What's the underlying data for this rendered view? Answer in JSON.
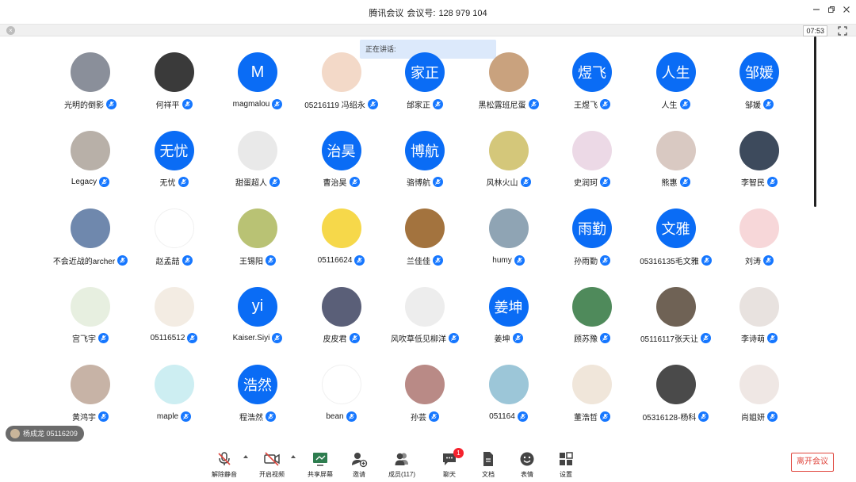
{
  "window": {
    "app_name": "腾讯会议",
    "meeting_label": "会议号:",
    "meeting_id": "128 979 104"
  },
  "infobar": {
    "timer": "07:53"
  },
  "speaking": {
    "label": "正在讲话:"
  },
  "participants": [
    {
      "name": "光明的倒影",
      "avatar_text": "",
      "kind": "pic",
      "color": "#8a8f9a"
    },
    {
      "name": "何祥平",
      "avatar_text": "",
      "kind": "pic",
      "color": "#3a3a3a"
    },
    {
      "name": "magmalou",
      "avatar_text": "M",
      "kind": "blue"
    },
    {
      "name": "05216119 冯绍永",
      "avatar_text": "",
      "kind": "pic",
      "color": "#f3d9c8"
    },
    {
      "name": "邰家正",
      "avatar_text": "家正",
      "kind": "blue"
    },
    {
      "name": "黑松露班尼蛋",
      "avatar_text": "",
      "kind": "pic",
      "color": "#c9a27e"
    },
    {
      "name": "王煜飞",
      "avatar_text": "煜飞",
      "kind": "blue"
    },
    {
      "name": "人生",
      "avatar_text": "人生",
      "kind": "blue"
    },
    {
      "name": "邹媛",
      "avatar_text": "邹媛",
      "kind": "blue"
    },
    {
      "name": "Legacy",
      "avatar_text": "",
      "kind": "pic",
      "color": "#b8b0a8"
    },
    {
      "name": "无忧",
      "avatar_text": "无忧",
      "kind": "blue"
    },
    {
      "name": "甜蛋超人",
      "avatar_text": "",
      "kind": "pic",
      "color": "#e9e9e9"
    },
    {
      "name": "曹治昊",
      "avatar_text": "治昊",
      "kind": "blue"
    },
    {
      "name": "骆博航",
      "avatar_text": "博航",
      "kind": "blue"
    },
    {
      "name": "风林火山",
      "avatar_text": "",
      "kind": "pic",
      "color": "#d4c77a"
    },
    {
      "name": "史润珂",
      "avatar_text": "",
      "kind": "pic",
      "color": "#ecd9e6"
    },
    {
      "name": "熊惠",
      "avatar_text": "",
      "kind": "pic",
      "color": "#d9c9c2"
    },
    {
      "name": "李智民",
      "avatar_text": "",
      "kind": "pic",
      "color": "#3d4a5c"
    },
    {
      "name": "不会近战的archer",
      "avatar_text": "",
      "kind": "pic",
      "color": "#6f88ad"
    },
    {
      "name": "赵孟喆",
      "avatar_text": "",
      "kind": "pic",
      "color": "#ffffff"
    },
    {
      "name": "王锡阳",
      "avatar_text": "",
      "kind": "pic",
      "color": "#b9c274"
    },
    {
      "name": "05116624",
      "avatar_text": "",
      "kind": "pic",
      "color": "#f6d84a"
    },
    {
      "name": "兰佳佳",
      "avatar_text": "",
      "kind": "pic",
      "color": "#a3733e"
    },
    {
      "name": "humy",
      "avatar_text": "",
      "kind": "pic",
      "color": "#8fa4b4"
    },
    {
      "name": "孙雨勤",
      "avatar_text": "雨勤",
      "kind": "blue"
    },
    {
      "name": "05316135毛文雅",
      "avatar_text": "文雅",
      "kind": "blue"
    },
    {
      "name": "刘涛",
      "avatar_text": "",
      "kind": "pic",
      "color": "#f7d7d9"
    },
    {
      "name": "宫飞宇",
      "avatar_text": "",
      "kind": "pic",
      "color": "#e7efe0"
    },
    {
      "name": "05116512",
      "avatar_text": "",
      "kind": "pic",
      "color": "#f3ece3"
    },
    {
      "name": "Kaiser.Siyi",
      "avatar_text": "yi",
      "kind": "blue"
    },
    {
      "name": "皮皮君",
      "avatar_text": "",
      "kind": "pic",
      "color": "#5a5f78"
    },
    {
      "name": "风吹草低见柳洋",
      "avatar_text": "",
      "kind": "pic",
      "color": "#ededed"
    },
    {
      "name": "姜坤",
      "avatar_text": "姜坤",
      "kind": "blue"
    },
    {
      "name": "顾苏豫",
      "avatar_text": "",
      "kind": "pic",
      "color": "#4f8a5b"
    },
    {
      "name": "05116117张天让",
      "avatar_text": "",
      "kind": "pic",
      "color": "#6f6255"
    },
    {
      "name": "李诗萌",
      "avatar_text": "",
      "kind": "pic",
      "color": "#e8e2df"
    },
    {
      "name": "黄鸿宇",
      "avatar_text": "",
      "kind": "pic",
      "color": "#c7b3a6"
    },
    {
      "name": "maple",
      "avatar_text": "",
      "kind": "pic",
      "color": "#cdeef2"
    },
    {
      "name": "程浩然",
      "avatar_text": "浩然",
      "kind": "blue"
    },
    {
      "name": "bean",
      "avatar_text": "",
      "kind": "pic",
      "color": "#ffffff"
    },
    {
      "name": "孙芸",
      "avatar_text": "",
      "kind": "pic",
      "color": "#b98a86"
    },
    {
      "name": "051164",
      "avatar_text": "",
      "kind": "pic",
      "color": "#9cc6d8"
    },
    {
      "name": "董浩哲",
      "avatar_text": "",
      "kind": "pic",
      "color": "#f0e6da"
    },
    {
      "name": "05316128-杨科",
      "avatar_text": "",
      "kind": "pic",
      "color": "#4a4a4a"
    },
    {
      "name": "尚姐妍",
      "avatar_text": "",
      "kind": "pic",
      "color": "#efe7e4"
    }
  ],
  "toast": {
    "text": "杨成龙 05116209"
  },
  "toolbar": {
    "unmute": "解除静音",
    "start_video": "开启视频",
    "share_screen": "共享屏幕",
    "invite": "邀请",
    "members": "成员(117)",
    "chat": "聊天",
    "chat_badge": "1",
    "docs": "文档",
    "reactions": "表情",
    "settings": "设置",
    "leave": "离开会议"
  },
  "colors": {
    "accent": "#0a6cf5",
    "mic": "#1677ff",
    "leave": "#e0463d",
    "badge": "#f5222d"
  }
}
